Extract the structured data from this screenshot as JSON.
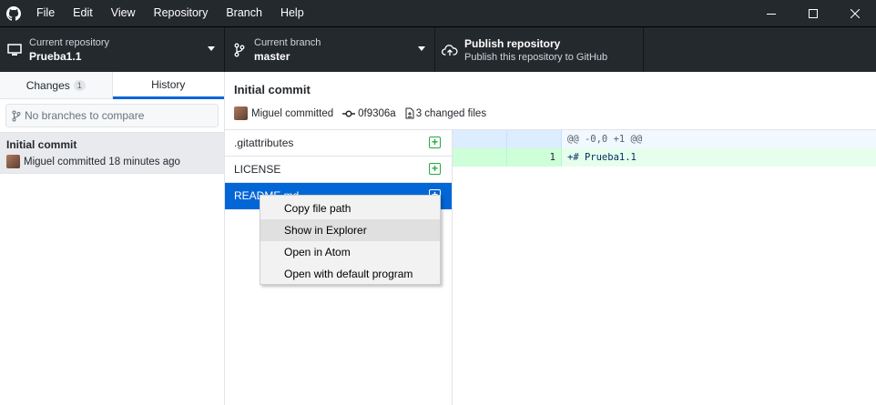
{
  "menubar": {
    "items": [
      "File",
      "Edit",
      "View",
      "Repository",
      "Branch",
      "Help"
    ],
    "icons": {
      "logo": "github-logo",
      "minimize": "minimize-icon",
      "maximize": "maximize-icon",
      "close": "close-icon"
    }
  },
  "toolbar": {
    "repo": {
      "label": "Current repository",
      "value": "Prueba1.1"
    },
    "branch": {
      "label": "Current branch",
      "value": "master"
    },
    "publish": {
      "label": "Publish repository",
      "value": "Publish this repository to GitHub"
    }
  },
  "sidebar": {
    "tabs": [
      {
        "label": "Changes",
        "badge": "1"
      },
      {
        "label": "History"
      }
    ],
    "compare_placeholder": "No branches to compare",
    "commits": [
      {
        "title": "Initial commit",
        "meta": "Miguel committed 18 minutes ago"
      }
    ]
  },
  "commit": {
    "title": "Initial commit",
    "author": "Miguel committed",
    "sha": "0f9306a",
    "changed": "3 changed files"
  },
  "files": [
    {
      "name": ".gitattributes",
      "status": "added"
    },
    {
      "name": "LICENSE",
      "status": "added"
    },
    {
      "name": "README.md",
      "status": "added"
    }
  ],
  "diff": {
    "hunk": "@@ -0,0 +1 @@",
    "lines": [
      {
        "new_line": "1",
        "text": "+# Prueba1.1"
      }
    ]
  },
  "context_menu": {
    "items": [
      "Copy file path",
      "Show in Explorer",
      "Open in Atom",
      "Open with default program"
    ]
  },
  "colors": {
    "accent": "#0366d6",
    "dark": "#24292e",
    "added": "#28a745"
  }
}
